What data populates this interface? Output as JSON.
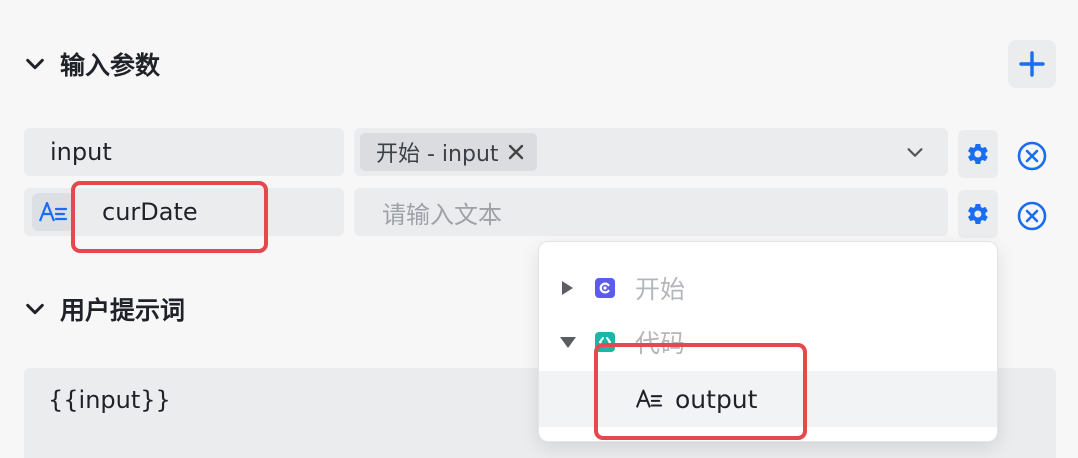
{
  "input_section": {
    "title": "输入参数"
  },
  "params": [
    {
      "name": "input",
      "value_tag": "开始 - input"
    },
    {
      "name": "curDate",
      "placeholder": "请输入文本"
    }
  ],
  "prompt_section": {
    "title": "用户提示词",
    "content": "{{input}}"
  },
  "variable_picker": {
    "nodes": [
      {
        "label": "开始",
        "expanded": false,
        "icon": "start-node-icon",
        "icon_color": "#5b5bf0"
      },
      {
        "label": "代码",
        "expanded": true,
        "icon": "code-node-icon",
        "icon_color": "#1cb5a8"
      }
    ],
    "selected_output": "output"
  },
  "colors": {
    "accent": "#1a6cf0",
    "highlight": "#e5484d"
  },
  "icons": [
    "chevron-down-icon",
    "plus-icon",
    "close-icon",
    "gear-icon",
    "remove-circle-icon",
    "text-type-icon",
    "caret-right-icon",
    "caret-down-icon"
  ]
}
